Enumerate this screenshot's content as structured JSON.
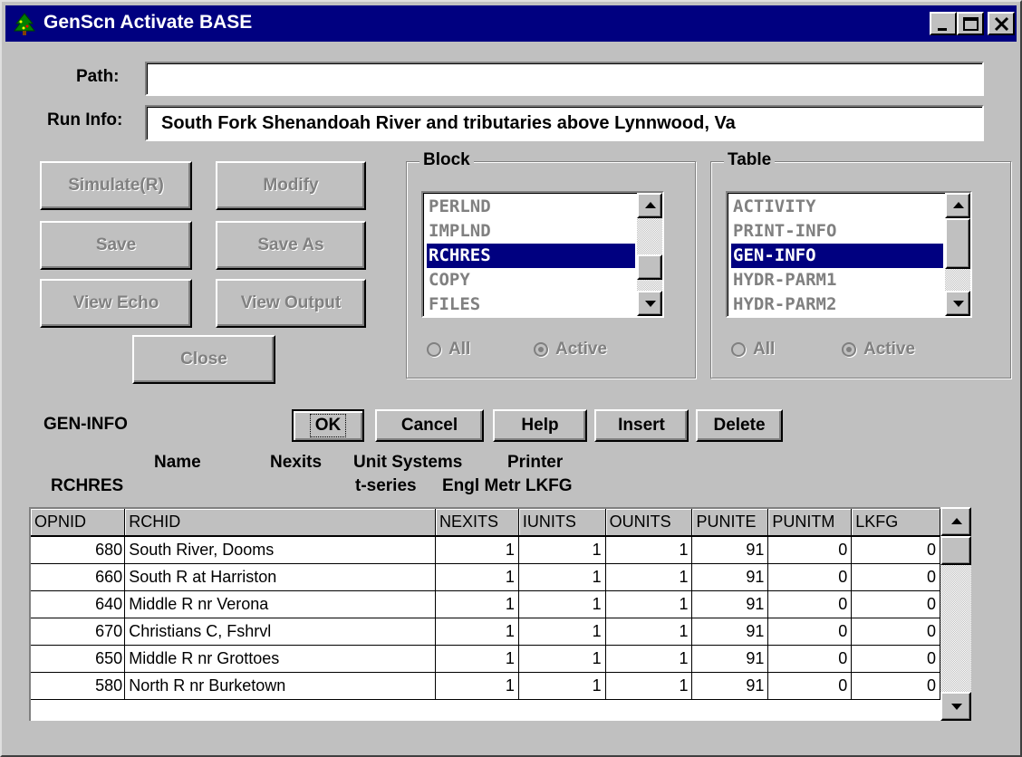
{
  "window": {
    "title": "GenScn Activate BASE"
  },
  "path": {
    "label": "Path:",
    "value": ""
  },
  "run_info": {
    "label": "Run Info:",
    "value": "South Fork Shenandoah River and tributaries above Lynnwood, Va"
  },
  "buttons": {
    "simulate": "Simulate(R)",
    "modify": "Modify",
    "save": "Save",
    "save_as": "Save As",
    "view_echo": "View Echo",
    "view_output": "View Output",
    "close": "Close"
  },
  "block": {
    "title": "Block",
    "items": [
      "PERLND",
      "IMPLND",
      "RCHRES",
      "COPY",
      "FILES"
    ],
    "selected": "RCHRES",
    "radio_all": "All",
    "radio_active": "Active"
  },
  "table": {
    "title": "Table",
    "items": [
      "ACTIVITY",
      "PRINT-INFO",
      "GEN-INFO",
      "HYDR-PARM1",
      "HYDR-PARM2"
    ],
    "selected": "GEN-INFO",
    "radio_all": "All",
    "radio_active": "Active"
  },
  "section": {
    "name": "GEN-INFO",
    "ok": "OK",
    "cancel": "Cancel",
    "help": "Help",
    "insert": "Insert",
    "delete": "Delete"
  },
  "header_labels": {
    "name": "Name",
    "nexits": "Nexits",
    "unit_systems": "Unit Systems",
    "printer": "Printer",
    "rchres": "RCHRES",
    "tseries": "t-series",
    "engl_metr_lkfg": "Engl Metr LKFG"
  },
  "grid": {
    "columns": [
      "OPNID",
      "RCHID",
      "NEXITS",
      "IUNITS",
      "OUNITS",
      "PUNITE",
      "PUNITM",
      "LKFG"
    ],
    "rows": [
      [
        "680",
        "South River, Dooms",
        "1",
        "1",
        "1",
        "91",
        "0",
        "0"
      ],
      [
        "660",
        "South R at Harriston",
        "1",
        "1",
        "1",
        "91",
        "0",
        "0"
      ],
      [
        "640",
        "Middle R nr Verona",
        "1",
        "1",
        "1",
        "91",
        "0",
        "0"
      ],
      [
        "670",
        "Christians C, Fshrvl",
        "1",
        "1",
        "1",
        "91",
        "0",
        "0"
      ],
      [
        "650",
        "Middle R nr Grottoes",
        "1",
        "1",
        "1",
        "91",
        "0",
        "0"
      ],
      [
        "580",
        "North R nr Burketown",
        "1",
        "1",
        "1",
        "91",
        "0",
        "0"
      ]
    ]
  },
  "icons": {
    "app": "tree-icon",
    "minimize": "minimize-icon",
    "maximize": "maximize-icon",
    "close": "close-icon",
    "scroll_up": "arrow-up-icon",
    "scroll_down": "arrow-down-icon"
  },
  "colors": {
    "titlebar": "#000080",
    "face": "#c0c0c0",
    "selection": "#000080"
  }
}
